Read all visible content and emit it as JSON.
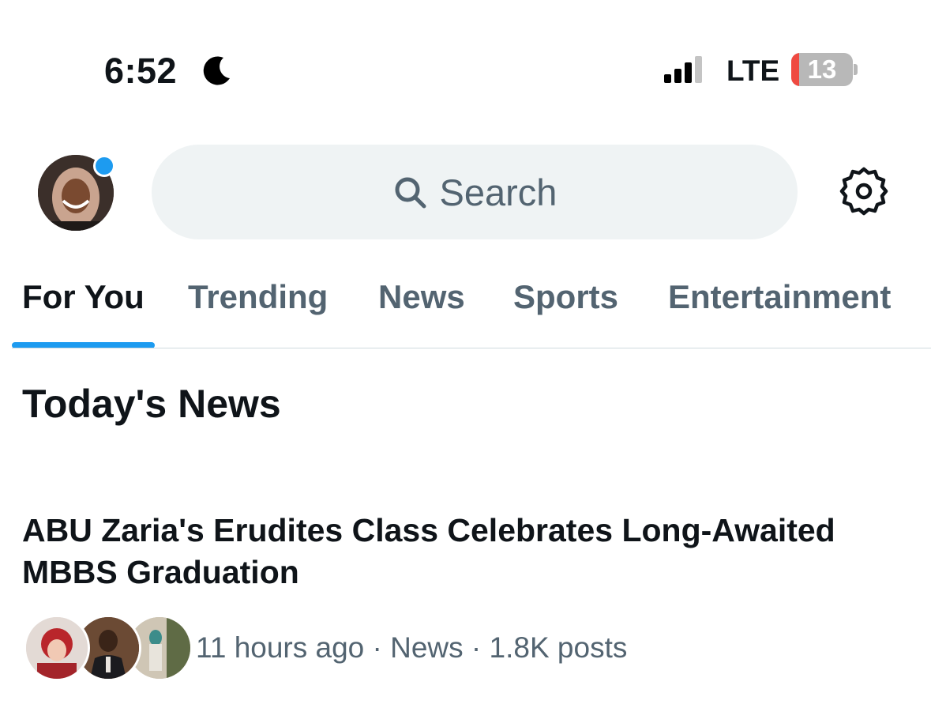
{
  "status_bar": {
    "time": "6:52",
    "network": "LTE",
    "battery": "13",
    "battery_level": 0.13
  },
  "header": {
    "search_placeholder": "Search"
  },
  "tabs": [
    {
      "label": "For You",
      "active": true
    },
    {
      "label": "Trending",
      "active": false
    },
    {
      "label": "News",
      "active": false
    },
    {
      "label": "Sports",
      "active": false
    },
    {
      "label": "Entertainment",
      "active": false
    }
  ],
  "content": {
    "section_title": "Today's News",
    "story": {
      "headline": "ABU Zaria's Erudites Class Celebrates Long-Awaited MBBS Graduation",
      "meta": "11 hours ago · News · 1.8K posts"
    }
  },
  "colors": {
    "accent": "#1d9bf0",
    "text_primary": "#0f1419",
    "text_secondary": "#536471",
    "search_bg": "#eff3f4",
    "battery_low": "#ef4a41"
  },
  "icons": [
    "moon-icon",
    "signal-icon",
    "battery-icon",
    "search-icon",
    "gear-icon"
  ]
}
